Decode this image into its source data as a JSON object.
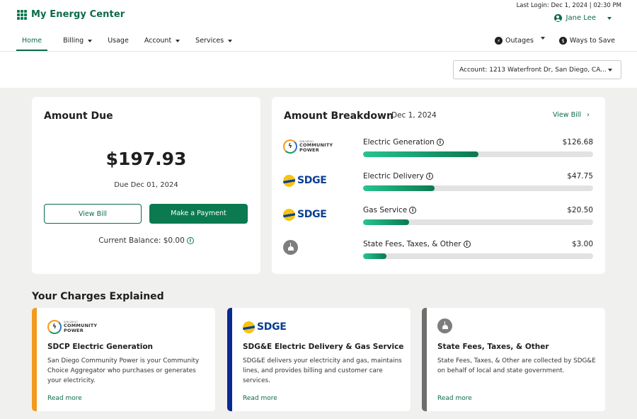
{
  "header": {
    "app_title": "My Energy Center",
    "last_login": "Last Login: Dec 1, 2024 | 02:30 PM",
    "user_name": "Jane Lee"
  },
  "nav": {
    "items": [
      {
        "label": "Home",
        "active": true,
        "dropdown": false
      },
      {
        "label": "Billing",
        "active": false,
        "dropdown": true
      },
      {
        "label": "Usage",
        "active": false,
        "dropdown": false
      },
      {
        "label": "Account",
        "active": false,
        "dropdown": true
      },
      {
        "label": "Services",
        "active": false,
        "dropdown": true
      }
    ],
    "right": {
      "outages": "Outages",
      "ways_to_save": "Ways to Save"
    }
  },
  "account_selector": {
    "value": "Account: 1213 Waterfront Dr, San Diego, CA..."
  },
  "amount_due": {
    "title": "Amount Due",
    "amount": "$197.93",
    "due_date": "Due Dec 01, 2024",
    "view_bill_label": "View Bill",
    "pay_label": "Make a Payment",
    "current_balance": "Current Balance: $0.00"
  },
  "breakdown": {
    "title": "Amount Breakdown",
    "date": "Dec 1, 2024",
    "view_bill_label": "View Bill",
    "rows": [
      {
        "label": "Electric Generation",
        "amount": "$126.68",
        "fraction": 0.5,
        "logo": "community-power",
        "info": true
      },
      {
        "label": "Electric Delivery",
        "amount": "$47.75",
        "fraction": 0.31,
        "logo": "sdge",
        "info": true
      },
      {
        "label": "Gas Service",
        "amount": "$20.50",
        "fraction": 0.2,
        "logo": "sdge",
        "info": true
      },
      {
        "label": "State Fees, Taxes, & Other",
        "amount": "$3.00",
        "fraction": 0.1,
        "logo": "government",
        "info": true
      }
    ]
  },
  "logos": {
    "cp_small": "SAN DIEGO",
    "cp_big_1": "COMMUNITY",
    "cp_big_2": "POWER",
    "sdge": "SDGE"
  },
  "charges": {
    "title": "Your Charges Explained",
    "cards": [
      {
        "title": "SDCP Electric Generation",
        "description": "San Diego Community Power is your Community Choice Aggregator who purchases or generates your electricity.",
        "link": "Read more",
        "accent": "#f29a1f"
      },
      {
        "title": "SDG&E Electric Delivery & Gas Service",
        "description": "SDG&E delivers your electricity and gas, maintains lines, and provides billing and customer care services.",
        "link": "Read more",
        "accent": "#0a2a8f"
      },
      {
        "title": "State Fees, Taxes, & Other",
        "description": "State Fees, Taxes, & Other are collected by SDG&E on behalf of local and state government.",
        "link": "Read more",
        "accent": "#6e6e6e"
      }
    ]
  },
  "colors": {
    "brand_green": "#0b7a50",
    "progress_start": "#27c48f"
  }
}
